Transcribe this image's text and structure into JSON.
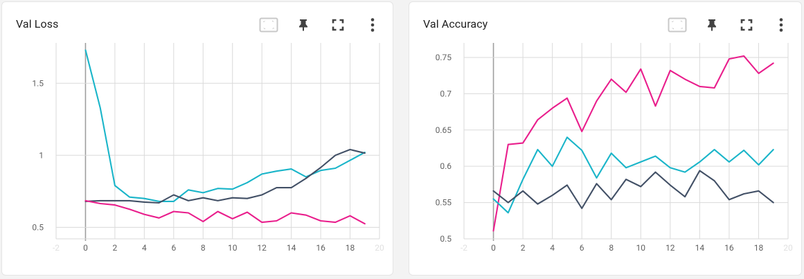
{
  "colors": {
    "series_pink": "#e91e8c",
    "series_cyan": "#1ab5c9",
    "series_slate": "#425066",
    "grid": "#dadada",
    "zero_axis": "#9e9e9e",
    "icon": "#5f6368"
  },
  "toolbar_icons": [
    "fit-domain-icon",
    "pin-icon",
    "fullscreen-icon",
    "more-vert-icon"
  ],
  "chart_data": [
    {
      "type": "line",
      "title": "Val Loss",
      "xlim": [
        -2,
        20
      ],
      "ylim": [
        0.42,
        1.78
      ],
      "grid": true,
      "x_ticks": [
        "-2",
        "0",
        "2",
        "4",
        "6",
        "8",
        "10",
        "12",
        "14",
        "16",
        "18",
        "20"
      ],
      "y_ticks": [
        "0.5",
        "1",
        "1.5"
      ],
      "y_tick_values": [
        0.5,
        1.0,
        1.5
      ],
      "series": [
        {
          "color": "cyan",
          "x": [
            0,
            1,
            2,
            3,
            4,
            5,
            6,
            7,
            8,
            9,
            10,
            11,
            12,
            13,
            14,
            15,
            16,
            17,
            18,
            19
          ],
          "values": [
            1.73,
            1.33,
            0.79,
            0.71,
            0.7,
            0.68,
            0.68,
            0.76,
            0.74,
            0.77,
            0.765,
            0.81,
            0.87,
            0.89,
            0.905,
            0.85,
            0.895,
            0.91,
            0.965,
            1.02
          ]
        },
        {
          "color": "slate",
          "x": [
            0,
            1,
            2,
            3,
            4,
            5,
            6,
            7,
            8,
            9,
            10,
            11,
            12,
            13,
            14,
            15,
            16,
            17,
            18,
            19
          ],
          "values": [
            0.68,
            0.685,
            0.685,
            0.685,
            0.675,
            0.67,
            0.725,
            0.685,
            0.705,
            0.685,
            0.705,
            0.7,
            0.725,
            0.775,
            0.775,
            0.84,
            0.915,
            1.0,
            1.04,
            1.015
          ]
        },
        {
          "color": "pink",
          "x": [
            0,
            1,
            2,
            3,
            4,
            5,
            6,
            7,
            8,
            9,
            10,
            11,
            12,
            13,
            14,
            15,
            16,
            17,
            18,
            19
          ],
          "values": [
            0.685,
            0.665,
            0.655,
            0.625,
            0.59,
            0.565,
            0.61,
            0.6,
            0.54,
            0.61,
            0.56,
            0.605,
            0.535,
            0.545,
            0.6,
            0.585,
            0.545,
            0.535,
            0.58,
            0.525
          ]
        }
      ]
    },
    {
      "type": "line",
      "title": "Val Accuracy",
      "xlim": [
        -2,
        20
      ],
      "ylim": [
        0.5,
        0.77
      ],
      "grid": true,
      "x_ticks": [
        "-2",
        "0",
        "2",
        "4",
        "6",
        "8",
        "10",
        "12",
        "14",
        "16",
        "18",
        "20"
      ],
      "y_ticks": [
        "0.5",
        "0.55",
        "0.6",
        "0.65",
        "0.7",
        "0.75"
      ],
      "y_tick_values": [
        0.5,
        0.55,
        0.6,
        0.65,
        0.7,
        0.75
      ],
      "series": [
        {
          "color": "pink",
          "x": [
            0,
            1,
            2,
            3,
            4,
            5,
            6,
            7,
            8,
            9,
            10,
            11,
            12,
            13,
            14,
            15,
            16,
            17,
            18,
            19
          ],
          "values": [
            0.511,
            0.63,
            0.632,
            0.664,
            0.68,
            0.694,
            0.648,
            0.69,
            0.72,
            0.702,
            0.734,
            0.683,
            0.732,
            0.72,
            0.71,
            0.708,
            0.748,
            0.752,
            0.728,
            0.742
          ]
        },
        {
          "color": "cyan",
          "x": [
            0,
            1,
            2,
            3,
            4,
            5,
            6,
            7,
            8,
            9,
            10,
            11,
            12,
            13,
            14,
            15,
            16,
            17,
            18,
            19
          ],
          "values": [
            0.555,
            0.536,
            0.582,
            0.623,
            0.6,
            0.64,
            0.622,
            0.584,
            0.618,
            0.598,
            0.606,
            0.614,
            0.598,
            0.592,
            0.606,
            0.623,
            0.606,
            0.622,
            0.602,
            0.623
          ]
        },
        {
          "color": "slate",
          "x": [
            0,
            1,
            2,
            3,
            4,
            5,
            6,
            7,
            8,
            9,
            10,
            11,
            12,
            13,
            14,
            15,
            16,
            17,
            18,
            19
          ],
          "values": [
            0.566,
            0.55,
            0.566,
            0.548,
            0.56,
            0.574,
            0.542,
            0.576,
            0.554,
            0.582,
            0.572,
            0.592,
            0.574,
            0.558,
            0.594,
            0.58,
            0.554,
            0.562,
            0.566,
            0.55
          ]
        }
      ]
    }
  ]
}
